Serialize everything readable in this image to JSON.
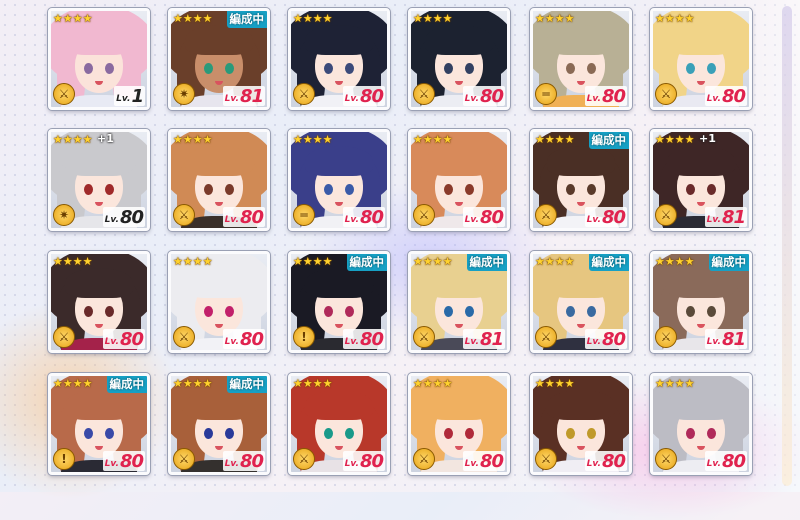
{
  "labels": {
    "in_party": "編成中",
    "lv_prefix": "Lv."
  },
  "cards": [
    {
      "stars": "★★★★",
      "plus": "",
      "badge": "",
      "weapon": "⚔",
      "level": "1",
      "lv_dark": true,
      "hair": "#f1b8d0",
      "eye": "#8a6aa0",
      "skin": "#fbe3da",
      "outfit": "#e8eaf4"
    },
    {
      "stars": "★★★★",
      "plus": "",
      "badge": "編成中",
      "weapon": "✷",
      "level": "81",
      "lv_dark": false,
      "hair": "#6a3f2a",
      "eye": "#2a9a7a",
      "skin": "#c98e6a",
      "outfit": "#e7e5ee"
    },
    {
      "stars": "★★★★",
      "plus": "",
      "badge": "",
      "weapon": "⚔",
      "level": "80",
      "lv_dark": false,
      "hair": "#1e2235",
      "eye": "#3b4a7a",
      "skin": "#fbe6dc",
      "outfit": "#f1f1f6"
    },
    {
      "stars": "★★★★",
      "plus": "",
      "badge": "",
      "weapon": "⚔",
      "level": "80",
      "lv_dark": false,
      "hair": "#1c2230",
      "eye": "#324061",
      "skin": "#fbe6dc",
      "outfit": "#ecedf3"
    },
    {
      "stars": "★★★★",
      "plus": "",
      "badge": "",
      "weapon": "═",
      "level": "80",
      "lv_dark": false,
      "hair": "#b8b095",
      "eye": "#8a6a55",
      "skin": "#fbe6dc",
      "outfit": "#f0b055"
    },
    {
      "stars": "★★★★",
      "plus": "",
      "badge": "",
      "weapon": "⚔",
      "level": "80",
      "lv_dark": false,
      "hair": "#f1d488",
      "eye": "#3aa0b8",
      "skin": "#fbe6dc",
      "outfit": "#e9e9f2"
    },
    {
      "stars": "★★★★",
      "plus": "+1",
      "badge": "",
      "weapon": "✷",
      "level": "80",
      "lv_dark": true,
      "hair": "#c9c9cd",
      "eye": "#a02a2a",
      "skin": "#fbe6dc",
      "outfit": "#e6e6ea"
    },
    {
      "stars": "★★★★",
      "plus": "",
      "badge": "",
      "weapon": "⚔",
      "level": "80",
      "lv_dark": false,
      "hair": "#d08a55",
      "eye": "#7a3a2a",
      "skin": "#fbe6dc",
      "outfit": "#3a2f2a"
    },
    {
      "stars": "★★★★",
      "plus": "",
      "badge": "",
      "weapon": "═",
      "level": "80",
      "lv_dark": false,
      "hair": "#3a3f8a",
      "eye": "#3a5aa8",
      "skin": "#fbe6dc",
      "outfit": "#f1f1f5"
    },
    {
      "stars": "★★★★",
      "plus": "",
      "badge": "",
      "weapon": "⚔",
      "level": "80",
      "lv_dark": false,
      "hair": "#d88a5a",
      "eye": "#8a3a2a",
      "skin": "#fbe6dc",
      "outfit": "#efe8ea"
    },
    {
      "stars": "★★★★",
      "plus": "",
      "badge": "編成中",
      "weapon": "⚔",
      "level": "80",
      "lv_dark": false,
      "hair": "#4a2f25",
      "eye": "#5a3a2a",
      "skin": "#fbe6dc",
      "outfit": "#f3f3f7"
    },
    {
      "stars": "★★★★",
      "plus": "+1",
      "badge": "",
      "weapon": "⚔",
      "level": "81",
      "lv_dark": false,
      "hair": "#3e2626",
      "eye": "#6a2a2a",
      "skin": "#fbe6dc",
      "outfit": "#2a2a34"
    },
    {
      "stars": "★★★★",
      "plus": "",
      "badge": "",
      "weapon": "⚔",
      "level": "80",
      "lv_dark": false,
      "hair": "#3b2a2a",
      "eye": "#6a2a2a",
      "skin": "#fbe6dc",
      "outfit": "#a4224a"
    },
    {
      "stars": "★★★★",
      "plus": "",
      "badge": "",
      "weapon": "⚔",
      "level": "80",
      "lv_dark": false,
      "hair": "#ececf0",
      "eye": "#c2206a",
      "skin": "#fbe6dc",
      "outfit": "#f2f2f6"
    },
    {
      "stars": "★★★★",
      "plus": "",
      "badge": "編成中",
      "weapon": "!",
      "level": "80",
      "lv_dark": false,
      "hair": "#1a1a24",
      "eye": "#b02a5a",
      "skin": "#fbe6dc",
      "outfit": "#2a2a30"
    },
    {
      "stars": "★★★★",
      "plus": "",
      "badge": "編成中",
      "weapon": "⚔",
      "level": "81",
      "lv_dark": false,
      "hair": "#e8d090",
      "eye": "#2a6aa8",
      "skin": "#fbe6dc",
      "outfit": "#4a4a58"
    },
    {
      "stars": "★★★★",
      "plus": "",
      "badge": "編成中",
      "weapon": "⚔",
      "level": "80",
      "lv_dark": false,
      "hair": "#e6c680",
      "eye": "#3a6aa0",
      "skin": "#fbe6dc",
      "outfit": "#2f3040"
    },
    {
      "stars": "★★★★",
      "plus": "",
      "badge": "編成中",
      "weapon": "⚔",
      "level": "81",
      "lv_dark": false,
      "hair": "#8a6a5a",
      "eye": "#5a4a3a",
      "skin": "#fbe6dc",
      "outfit": "#e8e6ea"
    },
    {
      "stars": "★★★★",
      "plus": "",
      "badge": "編成中",
      "weapon": "!",
      "level": "80",
      "lv_dark": false,
      "hair": "#b86a4a",
      "eye": "#3a4aa8",
      "skin": "#fbe6dc",
      "outfit": "#2a2a34"
    },
    {
      "stars": "★★★★",
      "plus": "",
      "badge": "編成中",
      "weapon": "⚔",
      "level": "80",
      "lv_dark": false,
      "hair": "#a8603a",
      "eye": "#2a3a9a",
      "skin": "#fbe6dc",
      "outfit": "#34302e"
    },
    {
      "stars": "★★★★",
      "plus": "",
      "badge": "",
      "weapon": "⚔",
      "level": "80",
      "lv_dark": false,
      "hair": "#b8382a",
      "eye": "#1a9a8a",
      "skin": "#fbe6dc",
      "outfit": "#e8e2e6"
    },
    {
      "stars": "★★★★",
      "plus": "",
      "badge": "",
      "weapon": "⚔",
      "level": "80",
      "lv_dark": false,
      "hair": "#f0b060",
      "eye": "#b02a3a",
      "skin": "#fbe6dc",
      "outfit": "#f2e6e0"
    },
    {
      "stars": "★★★★",
      "plus": "",
      "badge": "",
      "weapon": "⚔",
      "level": "80",
      "lv_dark": false,
      "hair": "#5a3024",
      "eye": "#c09a2a",
      "skin": "#fbe6dc",
      "outfit": "#f0eef4"
    },
    {
      "stars": "★★★★",
      "plus": "",
      "badge": "",
      "weapon": "⚔",
      "level": "80",
      "lv_dark": false,
      "hair": "#bcbcc4",
      "eye": "#b02a5a",
      "skin": "#fbe6dc",
      "outfit": "#ededf2"
    }
  ]
}
